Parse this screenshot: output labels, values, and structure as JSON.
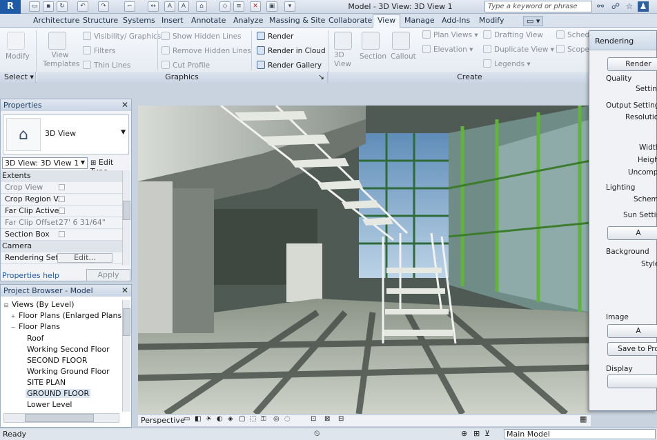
{
  "titlebar": {
    "app_logo": "R",
    "doc_title": "Model - 3D View: 3D View 1",
    "search_placeholder": "Type a keyword or phrase"
  },
  "tabs": [
    "Architecture",
    "Structure",
    "Systems",
    "Insert",
    "Annotate",
    "Analyze",
    "Massing & Site",
    "Collaborate",
    "View",
    "Manage",
    "Add-Ins",
    "Modify"
  ],
  "active_tab": "View",
  "ribbon": {
    "select_panel": {
      "modify": "Modify",
      "panel_label": "Select"
    },
    "graphics_panel": {
      "view_templates": "View Templates",
      "visibility_graphics": "Visibility/ Graphics",
      "filters": "Filters",
      "thin_lines": "Thin Lines",
      "show_hidden_lines": "Show Hidden Lines",
      "remove_hidden_lines": "Remove Hidden Lines",
      "cut_profile": "Cut Profile",
      "render": "Render",
      "render_in_cloud": "Render in Cloud",
      "render_gallery": "Render Gallery",
      "panel_label": "Graphics"
    },
    "create_panel": {
      "view_3d": "3D View",
      "section": "Section",
      "callout": "Callout",
      "plan_views": "Plan Views",
      "elevation": "Elevation",
      "drafting_view": "Drafting View",
      "duplicate_view": "Duplicate View",
      "legends": "Legends",
      "schedules": "Sched",
      "scope": "Scope",
      "panel_label": "Create"
    }
  },
  "properties": {
    "title": "Properties",
    "type_name": "3D View",
    "instance_selector": "3D View: 3D View 1",
    "edit_type": "Edit Type",
    "groups": [
      {
        "name": "Extents"
      },
      {
        "name": "Camera"
      }
    ],
    "rows": [
      {
        "label": "Crop View",
        "value": ""
      },
      {
        "label": "Crop Region V...",
        "value": ""
      },
      {
        "label": "Far Clip Active",
        "value": ""
      },
      {
        "label": "Far Clip Offset",
        "value": "27'  6 31/64\""
      },
      {
        "label": "Section Box",
        "value": ""
      },
      {
        "label": "Rendering Sett...",
        "value": "Edit..."
      }
    ],
    "help_link": "Properties help",
    "apply": "Apply"
  },
  "browser": {
    "title": "Project Browser - Model",
    "items": [
      {
        "label": "Views (By Level)",
        "level": 0
      },
      {
        "label": "Floor Plans (Enlarged Plans)",
        "level": 1
      },
      {
        "label": "Floor Plans",
        "level": 1
      },
      {
        "label": "Roof",
        "level": 2
      },
      {
        "label": "Working Second Floor",
        "level": 2
      },
      {
        "label": "SECOND FLOOR",
        "level": 2
      },
      {
        "label": "Working Ground Floor",
        "level": 2
      },
      {
        "label": "SITE PLAN",
        "level": 2
      },
      {
        "label": "GROUND FLOOR",
        "level": 2,
        "selected": true
      },
      {
        "label": "Lower Level",
        "level": 2
      }
    ]
  },
  "viewbar": {
    "mode": "Perspective"
  },
  "statusbar": {
    "left": "Ready",
    "model_selector": "Main Model"
  },
  "rendering_dialog": {
    "title": "Rendering",
    "render_button": "Render",
    "quality": "Quality",
    "setting": "Setting:",
    "output_settings": "Output Settings",
    "resolution": "Resolution:",
    "width": "Width:",
    "height": "Height:",
    "uncompressed": "Uncompre",
    "lighting": "Lighting",
    "scheme": "Scheme",
    "sun_setting": "Sun Setting:",
    "background": "Background",
    "style": "Style:",
    "image": "Image",
    "adjust_button": "A",
    "save_to_project": "Save to Pro",
    "display": "Display"
  },
  "colors": {
    "accent": "#1f5aa6",
    "glass_frame": "#5fb43a",
    "ribbon_bg": "#eef2f7"
  }
}
